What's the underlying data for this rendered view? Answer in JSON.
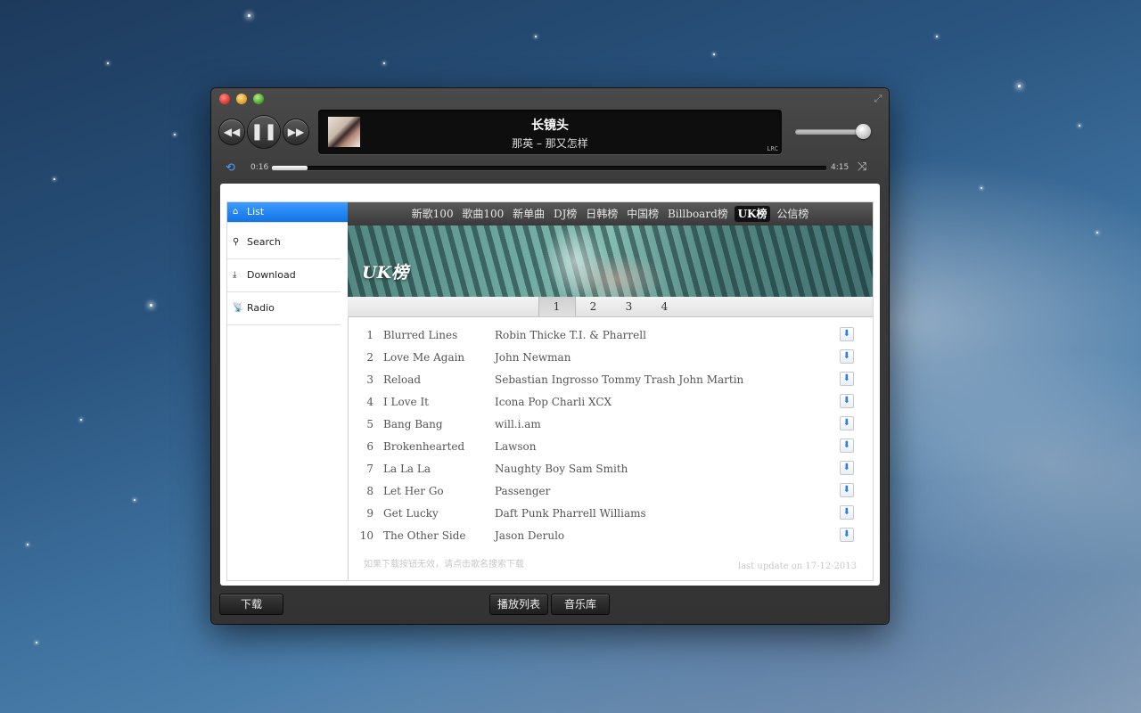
{
  "player": {
    "song_title": "长镜头",
    "song_artist": "那英 – 那又怎样",
    "lrc_label": "LRC",
    "time_elapsed": "0:16",
    "time_total": "4:15",
    "progress_fraction": 0.064,
    "volume_fraction": 1.0
  },
  "sidebar": {
    "items": [
      {
        "label": "List",
        "icon": "home-icon",
        "active": true
      },
      {
        "label": "Search",
        "icon": "search-icon"
      },
      {
        "label": "Download",
        "icon": "download-icon"
      },
      {
        "label": "Radio",
        "icon": "radio-icon"
      }
    ]
  },
  "tabs": [
    "新歌100",
    "歌曲100",
    "新单曲",
    "DJ榜",
    "日韩榜",
    "中国榜",
    "Billboard榜",
    "UK榜",
    "公信榜"
  ],
  "active_tab": "UK榜",
  "banner": {
    "title": "UK榜"
  },
  "pages": [
    "1",
    "2",
    "3",
    "4"
  ],
  "active_page": "1",
  "tracks": [
    {
      "num": "1",
      "title": "Blurred Lines",
      "artist": "Robin Thicke T.I. & Pharrell"
    },
    {
      "num": "2",
      "title": "Love Me Again",
      "artist": "John Newman"
    },
    {
      "num": "3",
      "title": "Reload",
      "artist": "Sebastian Ingrosso Tommy Trash John Martin"
    },
    {
      "num": "4",
      "title": "I Love It",
      "artist": "Icona Pop Charli XCX"
    },
    {
      "num": "5",
      "title": "Bang Bang",
      "artist": "will.i.am"
    },
    {
      "num": "6",
      "title": "Brokenhearted",
      "artist": "Lawson"
    },
    {
      "num": "7",
      "title": "La La La",
      "artist": "Naughty Boy Sam Smith"
    },
    {
      "num": "8",
      "title": "Let Her Go",
      "artist": "Passenger"
    },
    {
      "num": "9",
      "title": "Get Lucky",
      "artist": "Daft Punk Pharrell Williams"
    },
    {
      "num": "10",
      "title": "The Other Side",
      "artist": "Jason Derulo"
    }
  ],
  "footer": {
    "hint": "如果下载按钮无效，请点击歌名搜索下载",
    "last_update": "last update on 17-12-2013"
  },
  "bottom_buttons": {
    "download": "下载",
    "playlist": "播放列表",
    "library": "音乐库"
  },
  "colors": {
    "accent": "#1274e6",
    "download_arrow": "#2f7de0"
  }
}
